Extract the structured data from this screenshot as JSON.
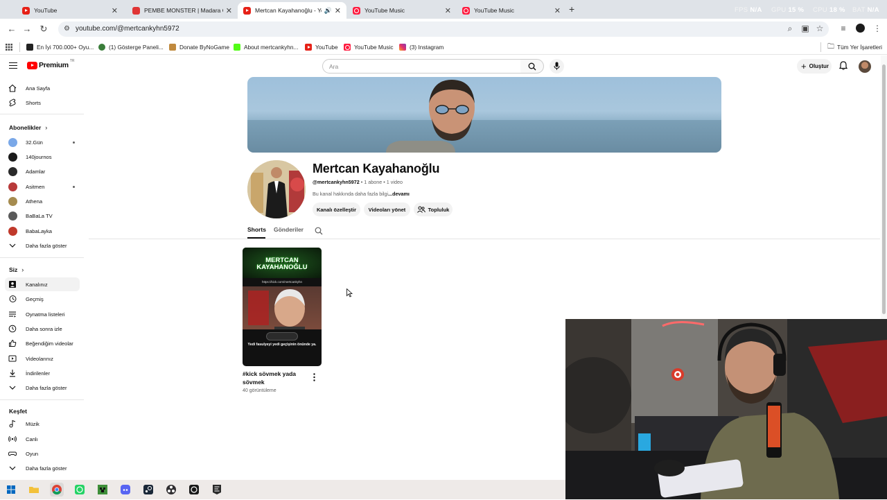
{
  "browser": {
    "tabs": [
      {
        "title": "YouTube",
        "favicon": "youtube-icon"
      },
      {
        "title": "PEMBE MONSTER | Madara Ol...",
        "favicon": "pembe-monster-icon"
      },
      {
        "title": "Mertcan Kayahanoğlu - You",
        "favicon": "youtube-icon",
        "active": true
      },
      {
        "title": "YouTube Music",
        "favicon": "youtube-music-icon"
      },
      {
        "title": "YouTube Music",
        "favicon": "youtube-music-icon"
      }
    ],
    "overlay": {
      "fps_label": "FPS",
      "fps_value": "N/A",
      "gpu_label": "GPU",
      "gpu_value": "15 %",
      "cpu_label": "CPU",
      "cpu_value": "18 %",
      "bat_label": "BAT",
      "bat_value": "N/A"
    },
    "url": "youtube.com/@mertcankyhn5972",
    "bookmarks": [
      "En İyi 700.000+ Oyu...",
      "(1) Gösterge Paneli...",
      "Donate ByNoGame",
      "About mertcankyhn...",
      "YouTube",
      "YouTube Music",
      "(3) Instagram"
    ],
    "all_bookmarks": "Tüm Yer İşaretleri"
  },
  "youtube": {
    "logo_text": "Premium",
    "logo_region": "TR",
    "search_placeholder": "Ara",
    "create_label": "Oluştur"
  },
  "sidebar": {
    "top": [
      {
        "label": "Ana Sayfa",
        "icon": "home-icon"
      },
      {
        "label": "Shorts",
        "icon": "shorts-icon"
      }
    ],
    "subs_heading": "Abonelikler",
    "subs": [
      {
        "label": "32.Gün",
        "color": "#7aa8e8",
        "dot": true
      },
      {
        "label": "140journos",
        "color": "#1a1a1a",
        "dot": false
      },
      {
        "label": "Adamlar",
        "color": "#2a2a2a",
        "dot": false
      },
      {
        "label": "Asitmen",
        "color": "#b83a3a",
        "dot": true
      },
      {
        "label": "Athena",
        "color": "#a58b4f",
        "dot": false
      },
      {
        "label": "BaBaLa TV",
        "color": "#5a5a5a",
        "dot": false
      },
      {
        "label": "BabaLayka",
        "color": "#c0392b",
        "dot": false
      }
    ],
    "subs_more": "Daha fazla göster",
    "you_heading": "Siz",
    "you": [
      {
        "label": "Kanalınız",
        "icon": "channel-icon",
        "active": true
      },
      {
        "label": "Geçmiş",
        "icon": "history-icon"
      },
      {
        "label": "Oynatma listeleri",
        "icon": "playlists-icon"
      },
      {
        "label": "Daha sonra izle",
        "icon": "watch-later-icon"
      },
      {
        "label": "Beğendiğim videolar",
        "icon": "like-icon"
      },
      {
        "label": "Videolarınız",
        "icon": "your-videos-icon"
      },
      {
        "label": "İndirilenler",
        "icon": "download-icon"
      },
      {
        "label": "Daha fazla göster",
        "icon": "chevron-down-icon"
      }
    ],
    "explore_heading": "Keşfet",
    "explore": [
      {
        "label": "Müzik",
        "icon": "music-icon"
      },
      {
        "label": "Canlı",
        "icon": "live-icon"
      },
      {
        "label": "Oyun",
        "icon": "gaming-icon"
      },
      {
        "label": "Daha fazla göster",
        "icon": "chevron-down-icon"
      }
    ]
  },
  "channel": {
    "name": "Mertcan Kayahanoğlu",
    "handle": "@mertcankyhn5972",
    "subs": "1 abone",
    "videos": "1 video",
    "description": "Bu kanal hakkında daha fazla bilgi",
    "more": "...devamı",
    "buttons": {
      "customize": "Kanalı özelleştir",
      "manage": "Videoları yönet",
      "community": "Topluluk"
    },
    "tabs": [
      "Shorts",
      "Gönderiler"
    ]
  },
  "short": {
    "title": "#kick sövmek yada sövmek",
    "views": "40 görüntüleme",
    "thumb_heading": "MERTCAN KAYAHANOĞLU",
    "thumb_url": "https://kick.com/mertcankyhn",
    "thumb_caption": "Yedi fasulyeyi yedi geçişinin önünde ya."
  }
}
